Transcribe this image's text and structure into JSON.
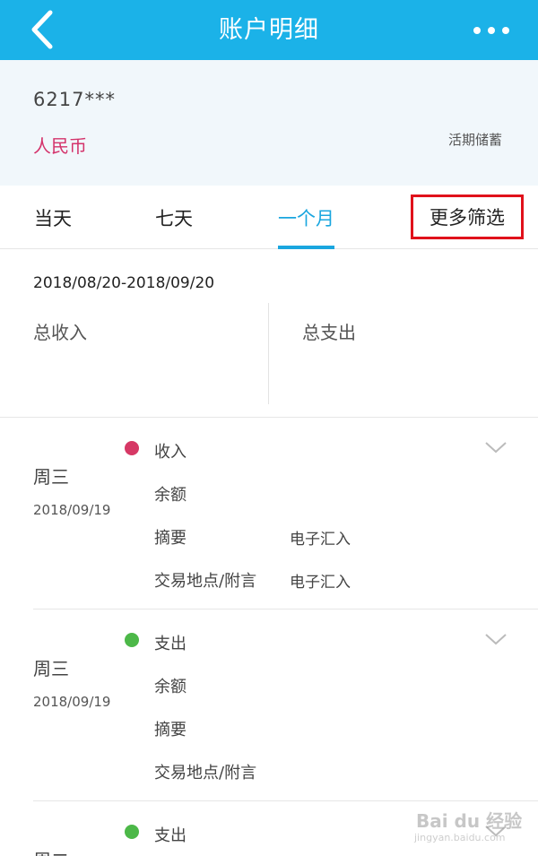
{
  "header": {
    "title": "账户明细",
    "bg_color": "#1bb2e8",
    "back_icon": "chevron-left-icon",
    "more_icon": "more-dots-icon"
  },
  "account": {
    "number": "6217***",
    "currency": "人民币",
    "type": "活期储蓄"
  },
  "tabs": [
    {
      "label": "当天"
    },
    {
      "label": "七天"
    },
    {
      "label": "一个月",
      "active": true
    },
    {
      "label": "更多筛选",
      "highlighted": true
    }
  ],
  "summary": {
    "range": "2018/08/20-2018/09/20",
    "income_label": "总收入",
    "expense_label": "总支出"
  },
  "records": [
    {
      "day": "周三",
      "date": "2018/09/19",
      "kind": "收入",
      "dot_color": "#d63865",
      "balance_label": "余额",
      "summary_label": "摘要",
      "summary_value": "电子汇入",
      "place_label": "交易地点/附言",
      "place_value": "电子汇入"
    },
    {
      "day": "周三",
      "date": "2018/09/19",
      "kind": "支出",
      "dot_color": "#4cb848",
      "balance_label": "余额",
      "summary_label": "摘要",
      "summary_value": "",
      "place_label": "交易地点/附言",
      "place_value": ""
    },
    {
      "day": "周二",
      "kind": "支出",
      "dot_color": "#4cb848"
    }
  ],
  "watermark": {
    "text": "Bai du 经验",
    "sub": "jingyan.baidu.com"
  }
}
